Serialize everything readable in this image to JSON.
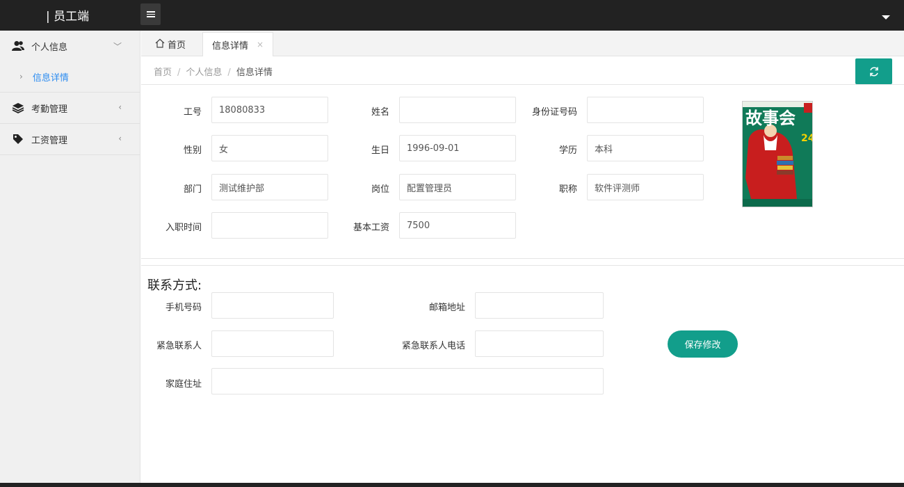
{
  "app": {
    "title": "| 员工端"
  },
  "sidebar": {
    "groups": [
      {
        "label": "个人信息",
        "icon": "users-icon",
        "arrow": "﹀"
      },
      {
        "label": "考勤管理",
        "icon": "layers-icon",
        "arrow": "‹"
      },
      {
        "label": "工资管理",
        "icon": "tag-icon",
        "arrow": "‹"
      }
    ],
    "sub_item": "信息详情"
  },
  "tabs": {
    "home": "首页",
    "active": "信息详情",
    "close": "×"
  },
  "breadcrumb": {
    "home": "首页",
    "section": "个人信息",
    "current": "信息详情",
    "sep": "/"
  },
  "form": {
    "emp_no": {
      "label": "工号",
      "value": "18080833"
    },
    "name": {
      "label": "姓名",
      "value": ""
    },
    "id_no": {
      "label": "身份证号码",
      "value": ""
    },
    "gender": {
      "label": "性别",
      "value": "女"
    },
    "birthday": {
      "label": "生日",
      "value": "1996-09-01"
    },
    "education": {
      "label": "学历",
      "value": "本科"
    },
    "department": {
      "label": "部门",
      "value": "测试维护部"
    },
    "position": {
      "label": "岗位",
      "value": "配置管理员"
    },
    "title": {
      "label": "职称",
      "value": "软件评测师"
    },
    "join_date": {
      "label": "入职时间",
      "value": ""
    },
    "base_salary": {
      "label": "基本工资",
      "value": "7500"
    }
  },
  "contact": {
    "heading": "联系方式:",
    "phone": {
      "label": "手机号码",
      "value": ""
    },
    "email": {
      "label": "邮箱地址",
      "value": ""
    },
    "emergency_contact": {
      "label": "紧急联系人",
      "value": ""
    },
    "emergency_phone": {
      "label": "紧急联系人电话",
      "value": ""
    },
    "address": {
      "label": "家庭住址",
      "value": ""
    },
    "save_label": "保存修改"
  },
  "cover": {
    "masthead": "故事会",
    "issue": "24"
  },
  "colors": {
    "accent": "#129e8b",
    "topbar": "#222222",
    "link": "#2d8cf0"
  }
}
